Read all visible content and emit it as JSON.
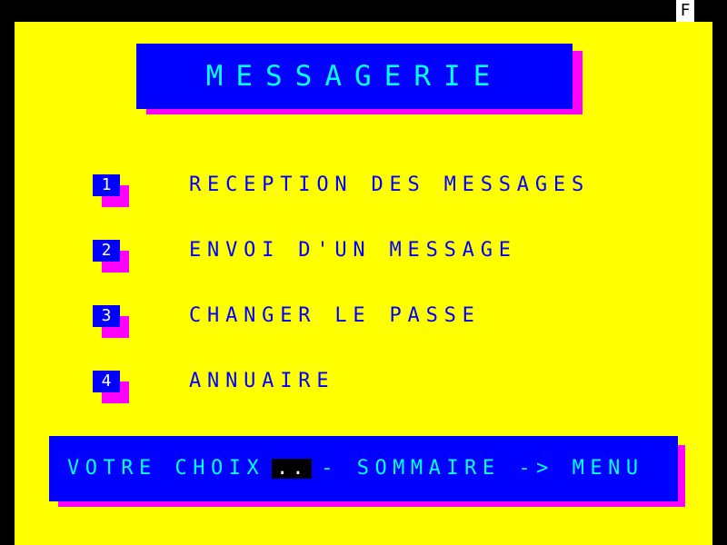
{
  "status": {
    "indicator": "F"
  },
  "title": "MESSAGERIE",
  "menu": {
    "items": [
      {
        "number": "1",
        "label": "RECEPTION DES MESSAGES"
      },
      {
        "number": "2",
        "label": "ENVOI D'UN MESSAGE"
      },
      {
        "number": "3",
        "label": "CHANGER LE PASSE"
      },
      {
        "number": "4",
        "label": "ANNUAIRE"
      }
    ]
  },
  "footer": {
    "prompt": "VOTRE CHOIX",
    "choice_value": "..",
    "hint": "- SOMMAIRE -> MENU"
  },
  "colors": {
    "background": "#ffff00",
    "panel": "#0000ff",
    "shadow": "#ff00ff",
    "title_text": "#00ffff",
    "menu_text": "#0000ff"
  }
}
